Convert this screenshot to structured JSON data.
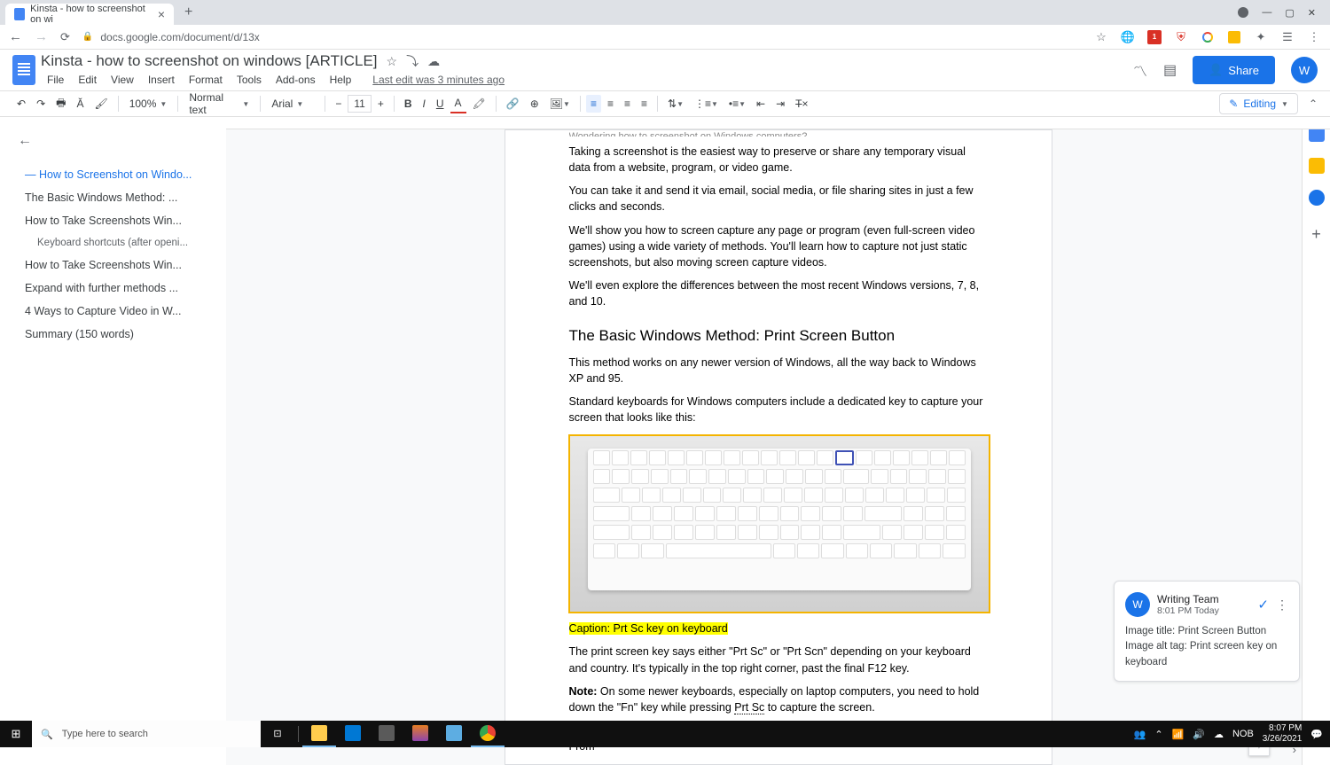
{
  "browser": {
    "tab_title": "Kinsta - how to screenshot on wi",
    "url": "docs.google.com/document/d/13x"
  },
  "doc": {
    "title": "Kinsta - how to screenshot on windows [ARTICLE]",
    "last_edit": "Last edit was 3 minutes ago",
    "menus": [
      "File",
      "Edit",
      "View",
      "Insert",
      "Format",
      "Tools",
      "Add-ons",
      "Help"
    ],
    "share_label": "Share",
    "avatar_letter": "W"
  },
  "toolbar": {
    "zoom": "100%",
    "style": "Normal text",
    "font": "Arial",
    "size": "11",
    "editing_label": "Editing"
  },
  "outline": {
    "items": [
      {
        "text": "How to Screenshot on Windo...",
        "active": true
      },
      {
        "text": "The Basic Windows Method: ..."
      },
      {
        "text": "How to Take Screenshots Win..."
      },
      {
        "text": "Keyboard shortcuts (after openi...",
        "sub": true
      },
      {
        "text": "How to Take Screenshots Win..."
      },
      {
        "text": "Expand with further methods ..."
      },
      {
        "text": "4 Ways to Capture Video in W..."
      },
      {
        "text": "Summary (150 words)"
      }
    ]
  },
  "content": {
    "cut_line": "Wondering how to screenshot on Windows computers?",
    "p1": "Taking a screenshot is the easiest way to preserve or share any temporary visual data from a website, program, or video game.",
    "p2": "You can take it and send it via email, social media, or file sharing sites in just a few clicks and seconds.",
    "p3": "We'll show you how to screen capture any page or program (even full-screen video games) using a wide variety of methods. You'll learn how to capture not just static screenshots, but also moving screen capture videos.",
    "p4": "We'll even explore the differences between the most recent Windows versions, 7, 8, and 10.",
    "h2": "The Basic Windows Method: Print Screen Button",
    "p5": "This method works on any newer version of Windows, all the way back to Windows XP and 95.",
    "p6": "Standard keyboards for Windows computers include a dedicated key to capture your screen that looks like this:",
    "caption": "Caption: Prt Sc key on keyboard",
    "p7": "The print screen key says either \"Prt Sc\" or \"Prt Scn\" depending on your keyboard and country. It's typically in the top right corner, past the final F12 key.",
    "note_label": "Note:",
    "p8_a": " On some newer keyboards, especially on laptop computers, you need to hold down the \"Fn\" key while pressing ",
    "p8_prtsc": "Prt Sc",
    "p8_b": " to capture the screen.",
    "p9": "When you use this method, the entire screen is automatically copied to the clipboard. From"
  },
  "comment": {
    "author": "Writing Team",
    "time": "8:01 PM Today",
    "body_line1": "Image title: Print Screen Button",
    "body_line2": "Image alt tag: Print screen key on keyboard",
    "avatar_letter": "W"
  },
  "taskbar": {
    "search_placeholder": "Type here to search",
    "lang": "NOB",
    "time": "8:07 PM",
    "date": "3/26/2021"
  }
}
